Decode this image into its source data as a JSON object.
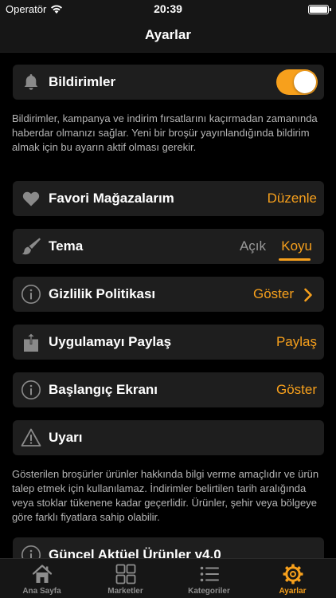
{
  "status_bar": {
    "carrier": "Operatör",
    "time": "20:39"
  },
  "nav": {
    "title": "Ayarlar"
  },
  "notifications": {
    "label": "Bildirimler",
    "enabled": true,
    "description": "Bildirimler, kampanya ve indirim fırsatlarını kaçırmadan zamanında haberdar olmanızı sağlar. Yeni bir broşür yayınlandığında bildirim almak için bu ayarın aktif olması gerekir."
  },
  "favorites": {
    "label": "Favori Mağazalarım",
    "action": "Düzenle"
  },
  "theme": {
    "label": "Tema",
    "options": [
      "Açık",
      "Koyu"
    ],
    "selected": "Koyu"
  },
  "privacy": {
    "label": "Gizlilik Politikası",
    "action": "Göster"
  },
  "share": {
    "label": "Uygulamayı Paylaş",
    "action": "Paylaş"
  },
  "start_screen": {
    "label": "Başlangıç Ekranı",
    "action": "Göster"
  },
  "warning": {
    "label": "Uyarı",
    "description": "Gösterilen broşürler ürünler hakkında bilgi verme amaçlıdır ve ürün talep etmek için kullanılamaz. İndirimler belirtilen tarih aralığında veya stoklar tükenene kadar geçerlidir. Ürünler, şehir veya bölgeye göre farklı fiyatlara sahip olabilir."
  },
  "version": {
    "label": "Güncel Aktüel Ürünler v4.0"
  },
  "tabs": [
    {
      "label": "Ana Sayfa",
      "icon": "home-icon"
    },
    {
      "label": "Marketler",
      "icon": "grid-icon"
    },
    {
      "label": "Kategoriler",
      "icon": "list-icon"
    },
    {
      "label": "Ayarlar",
      "icon": "gear-icon",
      "active": true
    }
  ],
  "colors": {
    "accent": "#f7a01c",
    "card": "#1e1e1e",
    "background": "#000000"
  }
}
